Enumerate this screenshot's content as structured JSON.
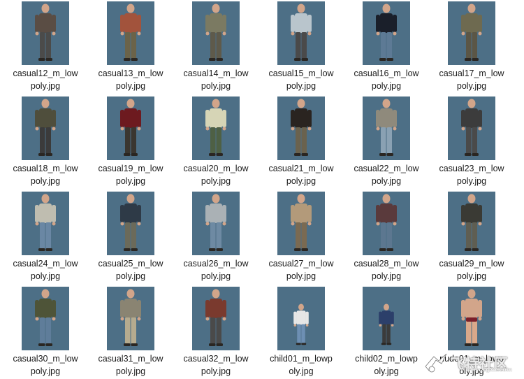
{
  "files": [
    {
      "name": "casual12_m_low\npoly.jpg",
      "shirt": "#5a4d44",
      "pants": "#4b4b4a"
    },
    {
      "name": "casual13_m_low\npoly.jpg",
      "shirt": "#a2533c",
      "pants": "#6b6349"
    },
    {
      "name": "casual14_m_low\npoly.jpg",
      "shirt": "#7b7a62",
      "pants": "#5e5a4b"
    },
    {
      "name": "casual15_m_low\npoly.jpg",
      "shirt": "#b9c5cc",
      "pants": "#4a4a4a"
    },
    {
      "name": "casual16_m_low\npoly.jpg",
      "shirt": "#1a1f2a",
      "pants": "#5d7a95"
    },
    {
      "name": "casual17_m_low\npoly.jpg",
      "shirt": "#6e6a50",
      "pants": "#5b5646"
    },
    {
      "name": "casual18_m_low\npoly.jpg",
      "shirt": "#4f4e3c",
      "pants": "#3b3b3b"
    },
    {
      "name": "casual19_m_low\npoly.jpg",
      "shirt": "#6d1a1f",
      "pants": "#3a3630"
    },
    {
      "name": "casual20_m_low\npoly.jpg",
      "shirt": "#d6d5b6",
      "pants": "#4e6045"
    },
    {
      "name": "casual21_m_low\npoly.jpg",
      "shirt": "#2a2420",
      "pants": "#6a624e"
    },
    {
      "name": "casual22_m_low\npoly.jpg",
      "shirt": "#8f8a7c",
      "pants": "#8aa1b3"
    },
    {
      "name": "casual23_m_low\npoly.jpg",
      "shirt": "#3c3c3c",
      "pants": "#4a4a4a"
    },
    {
      "name": "casual24_m_low\npoly.jpg",
      "shirt": "#bfbdb0",
      "pants": "#6a87a4"
    },
    {
      "name": "casual25_m_low\npoly.jpg",
      "shirt": "#2e3a47",
      "pants": "#6b6a5a"
    },
    {
      "name": "casual26_m_low\npoly.jpg",
      "shirt": "#aab1b5",
      "pants": "#6e8aa3"
    },
    {
      "name": "casual27_m_low\npoly.jpg",
      "shirt": "#b39a7a",
      "pants": "#7a6a52"
    },
    {
      "name": "casual28_m_low\npoly.jpg",
      "shirt": "#5a3a3c",
      "pants": "#5c7790"
    },
    {
      "name": "casual29_m_low\npoly.jpg",
      "shirt": "#3a3a34",
      "pants": "#5f5e52"
    },
    {
      "name": "casual30_m_low\npoly.jpg",
      "shirt": "#4e5438",
      "pants": "#5f7d9a"
    },
    {
      "name": "casual31_m_low\npoly.jpg",
      "shirt": "#8a8472",
      "pants": "#b5ab8f"
    },
    {
      "name": "casual32_m_low\npoly.jpg",
      "shirt": "#7a3a2e",
      "pants": "#4a4a4a"
    },
    {
      "name": "child01_m_lowp\noly.jpg",
      "shirt": "#e6e6e6",
      "pants": "#6d8fb3",
      "child": true
    },
    {
      "name": "child02_m_lowp\noly.jpg",
      "shirt": "#2c3f6a",
      "pants": "#3b3b3b",
      "child": true
    },
    {
      "name": "nude01_m_lowp\noly.jpg",
      "shirt": "#d9a88a",
      "pants": "#d9a88a",
      "nude": true
    }
  ],
  "watermark": {
    "text": "飞特社区",
    "sub": "www.cgxx.com"
  },
  "colors": {
    "thumb_bg": "#4d6f86",
    "skin": "#d2a58a"
  }
}
